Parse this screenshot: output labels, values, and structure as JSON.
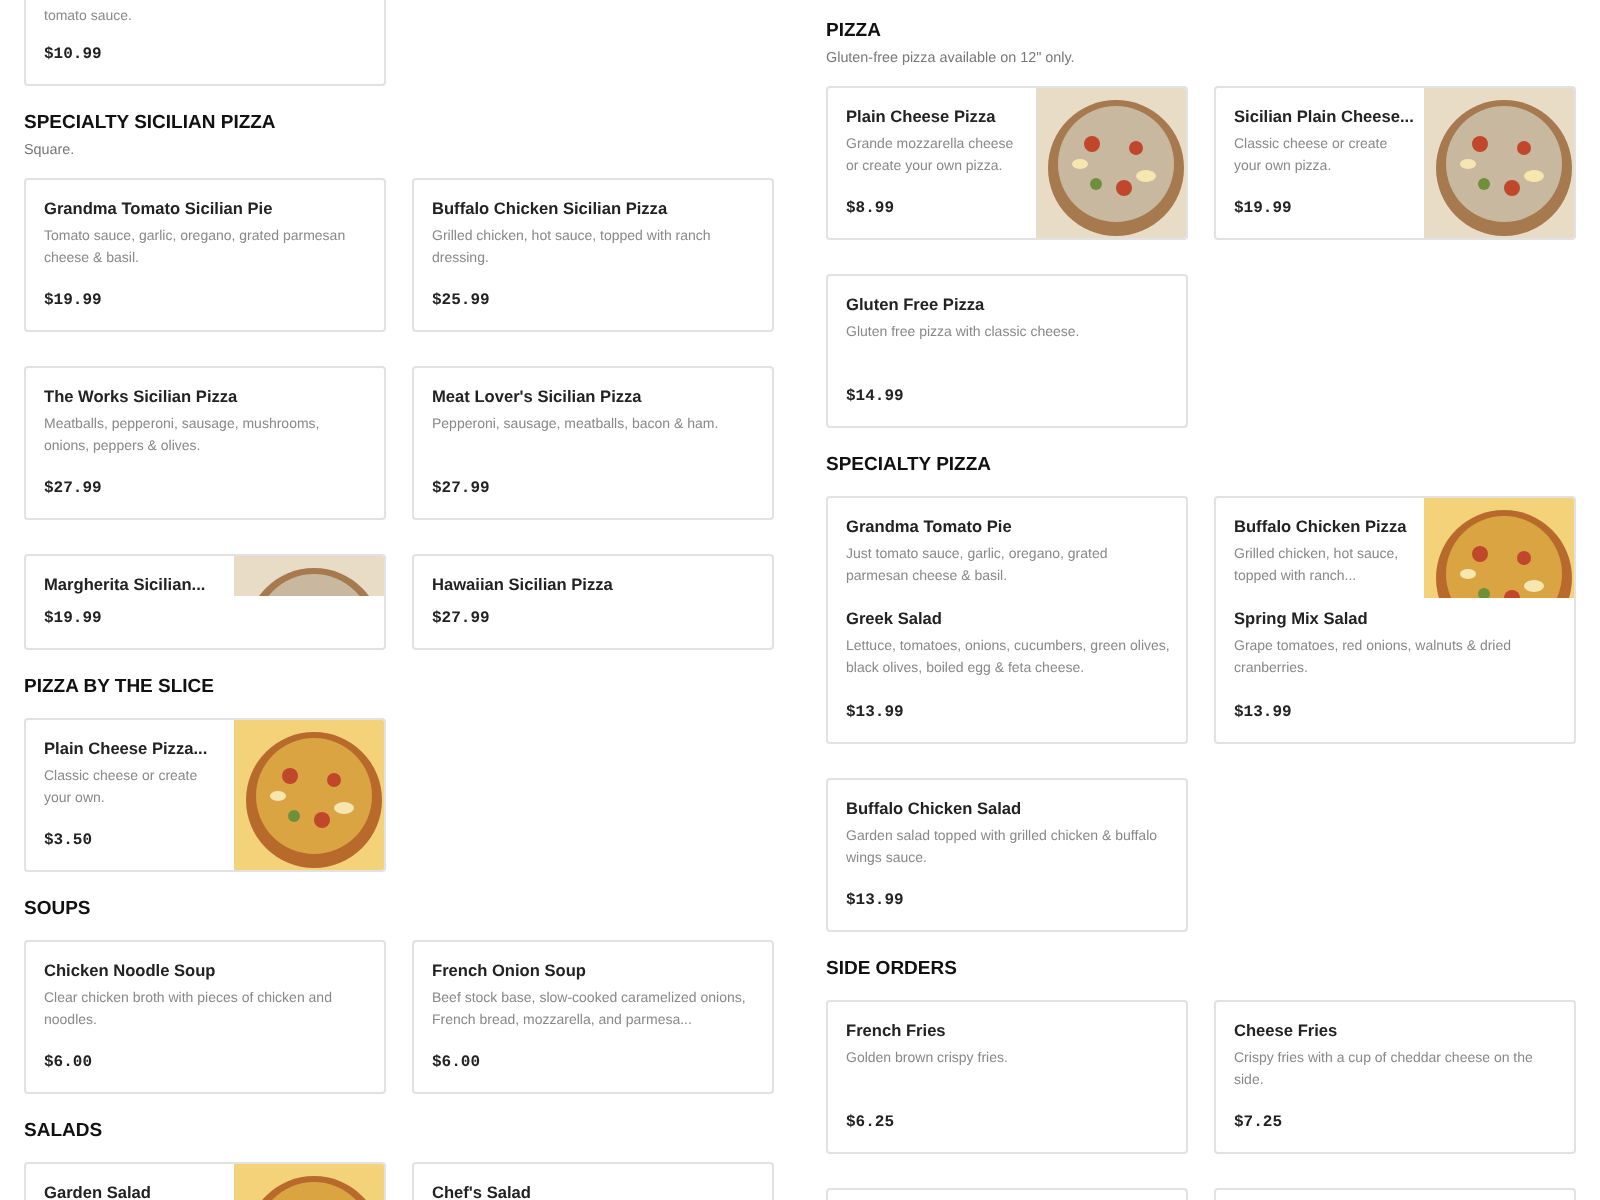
{
  "columns": [
    {
      "sections": [
        {
          "items": [
            {
              "kind": "top-cut",
              "description": "tomato sauce.",
              "price": "$10.99"
            }
          ]
        },
        {
          "heading": "SPECIALTY SICILIAN PIZZA",
          "note": "Square.",
          "items": [
            {
              "kind": "full",
              "name": "Grandma Tomato Sicilian Pie",
              "description": "Tomato sauce, garlic, oregano, grated parmesan cheese & basil.",
              "price": "$19.99"
            },
            {
              "kind": "full",
              "name": "Buffalo Chicken Sicilian Pizza",
              "description": "Grilled chicken, hot sauce, topped with ranch dressing.",
              "price": "$25.99"
            },
            {
              "kind": "full",
              "name": "The Works Sicilian Pizza",
              "description": "Meatballs, pepperoni, sausage, mushrooms, onions, peppers & olives.",
              "price": "$27.99"
            },
            {
              "kind": "full",
              "name": "Meat Lover's Sicilian Pizza",
              "description": "Pepperoni, sausage, meatballs, bacon & ham.",
              "price": "$27.99"
            },
            {
              "kind": "short",
              "name": "Margherita Sicilian...",
              "price": "$19.99"
            },
            {
              "kind": "short",
              "name": "Hawaiian Sicilian Pizza",
              "price": "$27.99"
            }
          ]
        },
        {
          "heading": "PIZZA BY THE SLICE",
          "items": [
            {
              "kind": "full",
              "name": "Plain Cheese Pizza...",
              "description": "Classic cheese or create your own.",
              "price": "$3.50"
            }
          ]
        },
        {
          "heading": "SOUPS",
          "items": [
            {
              "kind": "full",
              "name": "Chicken Noodle Soup",
              "description": "Clear chicken broth with pieces of chicken and noodles.",
              "price": "$6.00"
            },
            {
              "kind": "full",
              "name": "French Onion Soup",
              "description": "Beef stock base, slow-cooked caramelized onions, French bread, mozzarella, and parmesa...",
              "price": "$6.00"
            }
          ]
        },
        {
          "heading": "SALADS",
          "items": [
            {
              "kind": "full",
              "name": "Garden Salad"
            },
            {
              "kind": "full",
              "name": "Chef's Salad"
            }
          ]
        }
      ]
    },
    {
      "sections": [
        {
          "heading": "PIZZA",
          "note": "Gluten-free pizza available on 12\" only.",
          "items": [
            {
              "kind": "full",
              "name": "Plain Cheese Pizza",
              "description": "Grande mozzarella cheese or create your own pizza.",
              "price": "$8.99"
            },
            {
              "kind": "full",
              "name": "Sicilian Plain Cheese...",
              "description": "Classic cheese or create your own pizza.",
              "price": "$19.99"
            },
            {
              "kind": "full",
              "name": "Gluten Free Pizza",
              "description": "Gluten free pizza with classic cheese.",
              "price": "$14.99"
            }
          ]
        },
        {
          "heading": "SPECIALTY PIZZA",
          "items": [
            {
              "kind": "bottom-cut",
              "name": "Grandma Tomato Pie",
              "description": "Just tomato sauce, garlic, oregano, grated parmesan cheese & basil."
            },
            {
              "kind": "bottom-cut",
              "name": "Buffalo Chicken Pizza",
              "description": "Grilled chicken, hot sauce, topped with ranch..."
            },
            {
              "kind": "joined",
              "name": "Greek Salad",
              "description": "Lettuce, tomatoes, onions, cucumbers, green olives, black olives, boiled egg & feta cheese.",
              "price": "$13.99"
            },
            {
              "kind": "joined",
              "name": "Spring Mix Salad",
              "description": "Grape tomatoes, red onions, walnuts & dried cranberries.",
              "price": "$13.99"
            },
            {
              "kind": "full",
              "name": "Buffalo Chicken Salad",
              "description": "Garden salad topped with grilled chicken & buffalo wings sauce.",
              "price": "$13.99"
            }
          ]
        },
        {
          "heading": "SIDE ORDERS",
          "items": [
            {
              "kind": "full",
              "name": "French Fries",
              "description": "Golden brown crispy fries.",
              "price": "$6.25"
            },
            {
              "kind": "full",
              "name": "Cheese Fries",
              "description": "Crispy fries with a cup of cheddar cheese on the side.",
              "price": "$7.25"
            },
            {
              "kind": "full"
            },
            {
              "kind": "full"
            }
          ]
        }
      ]
    }
  ]
}
